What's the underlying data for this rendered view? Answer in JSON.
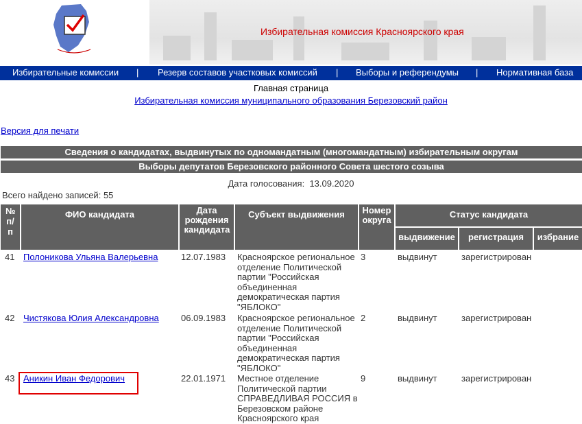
{
  "header": {
    "site_title": "Избирательная комиссия Красноярского края"
  },
  "nav": [
    {
      "label": "Избирательные комиссии"
    },
    {
      "label": "|"
    },
    {
      "label": "Резерв составов участковых комиссий"
    },
    {
      "label": "|"
    },
    {
      "label": "Выборы и референдумы"
    },
    {
      "label": "|"
    },
    {
      "label": "Нормативная база"
    }
  ],
  "breadcrumb": {
    "home": "Главная страница",
    "district": "Избирательная комиссия муниципального образования Березовский район"
  },
  "print_link": "Версия для печати",
  "report": {
    "title": "Сведения о кандидатах, выдвинутых по одномандатным (многомандатным) избирательным округам",
    "election": "Выборы депутатов Березовского районного Совета шестого созыва",
    "vote_date_label": "Дата голосования:",
    "vote_date": "13.09.2020",
    "found_label": "Всего найдено записей:",
    "found_count": "55"
  },
  "columns": {
    "num": "№ п/п",
    "name": "ФИО кандидата",
    "birth": "Дата рождения кандидата",
    "subject": "Субъект выдвижения",
    "district": "Номер округа",
    "status": "Статус кандидата",
    "nomination": "выдвижение",
    "registration": "регистрация",
    "election": "избрание"
  },
  "rows": [
    {
      "num": "41",
      "name": "Полоникова Ульяна Валерьевна",
      "birth": "12.07.1983",
      "subject": "Красноярское региональное отделение Политической партии \"Российская объединенная демократическая партия \"ЯБЛОКО\"",
      "district": "3",
      "nomination": "выдвинут",
      "registration": "зарегистрирован",
      "election": ""
    },
    {
      "num": "42",
      "name": "Чистякова Юлия Александровна",
      "birth": "06.09.1983",
      "subject": "Красноярское региональное отделение Политической партии \"Российская объединенная демократическая партия \"ЯБЛОКО\"",
      "district": "2",
      "nomination": "выдвинут",
      "registration": "зарегистрирован",
      "election": ""
    },
    {
      "num": "43",
      "name": "Аникин Иван Федорович",
      "birth": "22.01.1971",
      "subject": "Местное отделение Политической партии СПРАВЕДЛИВАЯ РОССИЯ в Березовском районе Красноярского края",
      "district": "9",
      "nomination": "выдвинут",
      "registration": "зарегистрирован",
      "election": ""
    }
  ],
  "colors": {
    "nav_bg": "#00309c",
    "header_gray": "#606060",
    "title_red": "#cc0000",
    "highlight": "#e00000"
  }
}
